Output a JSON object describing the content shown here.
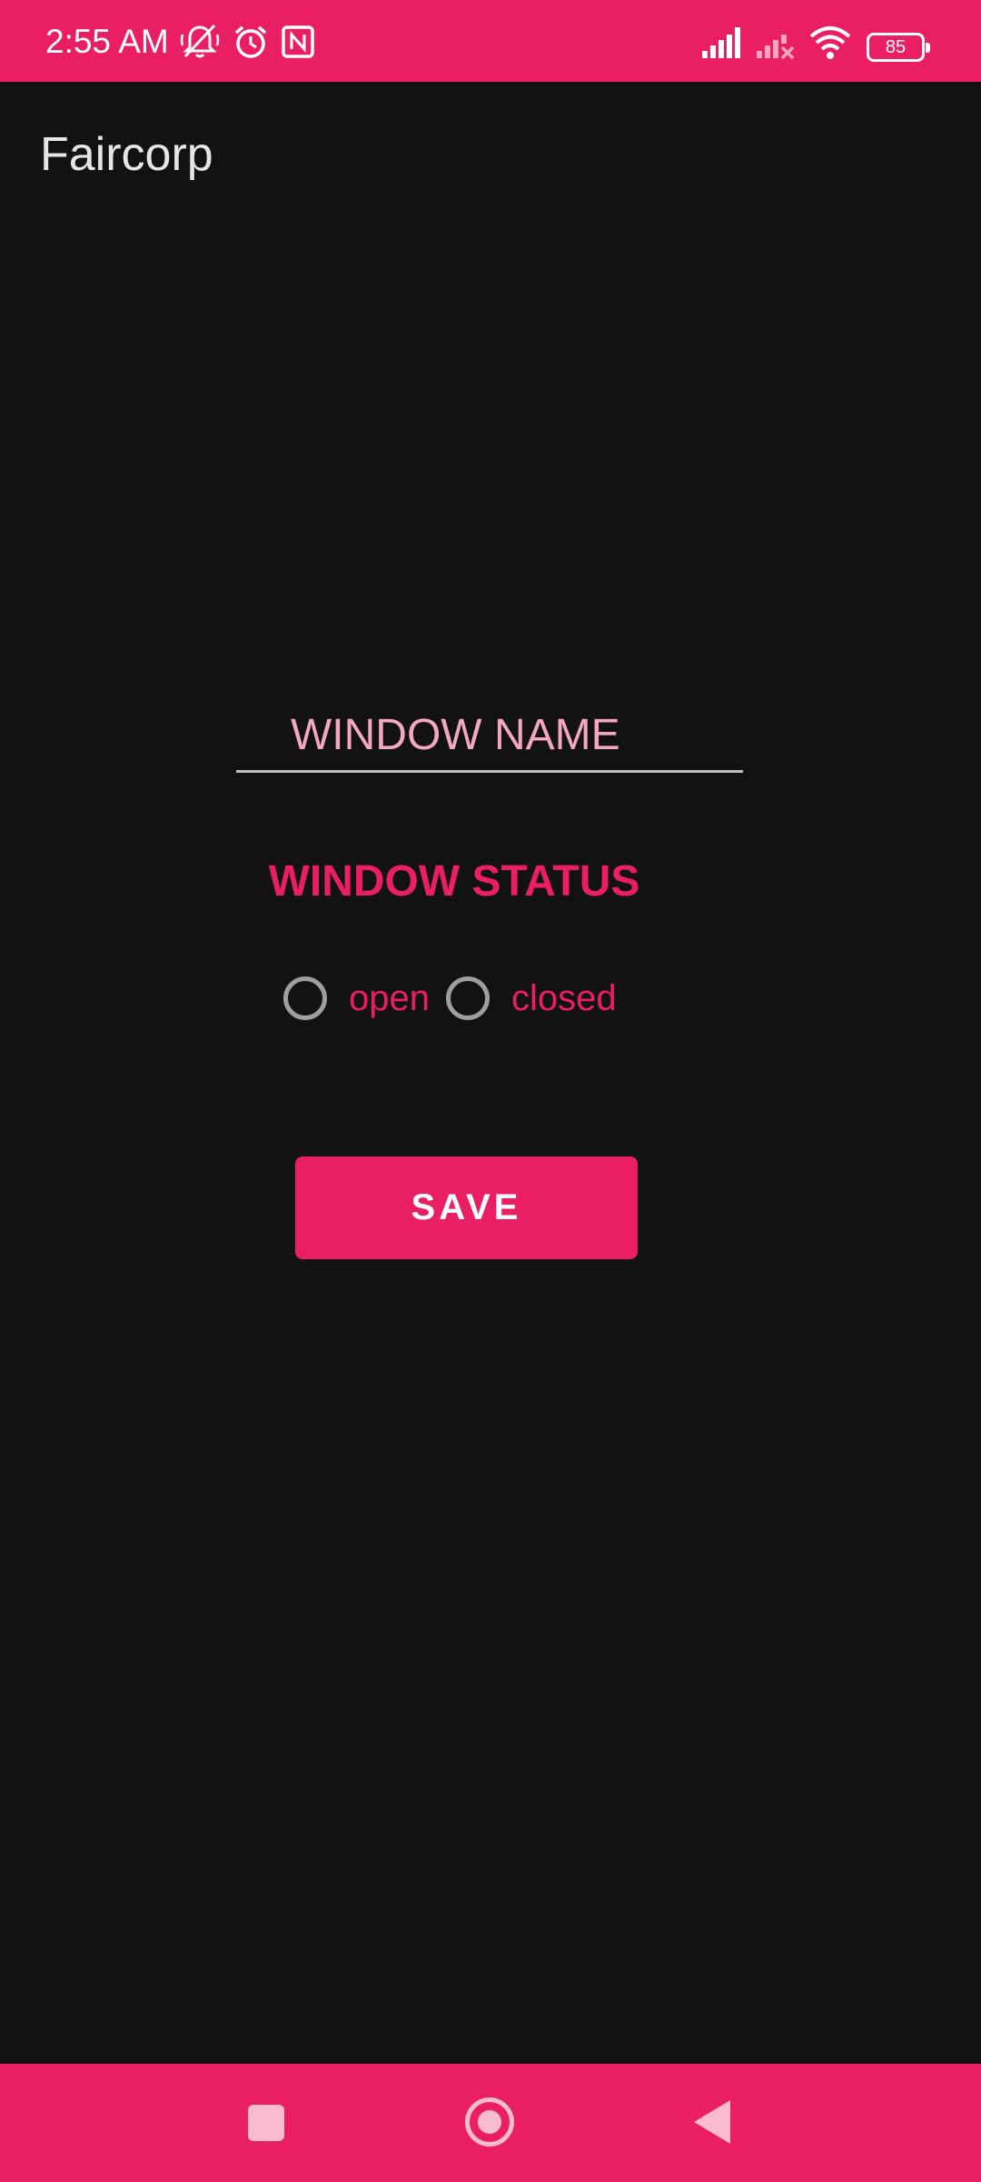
{
  "status_bar": {
    "time": "2:55 AM",
    "battery_level": "85",
    "icons": [
      "bell-off-icon",
      "alarm-icon",
      "nfc-icon",
      "signal-icon",
      "signal-no-service-icon",
      "wifi-icon",
      "battery-icon"
    ]
  },
  "app_bar": {
    "title": "Faircorp"
  },
  "form": {
    "name_placeholder": "WINDOW NAME",
    "status_heading": "WINDOW STATUS",
    "options": [
      "open",
      "closed"
    ],
    "save_label": "SAVE"
  },
  "nav_bar": {
    "icons": [
      "recents-icon",
      "home-icon",
      "back-icon"
    ]
  },
  "colors": {
    "accent": "#E91E63",
    "background": "#121212",
    "hint": "#F4A7C3"
  }
}
